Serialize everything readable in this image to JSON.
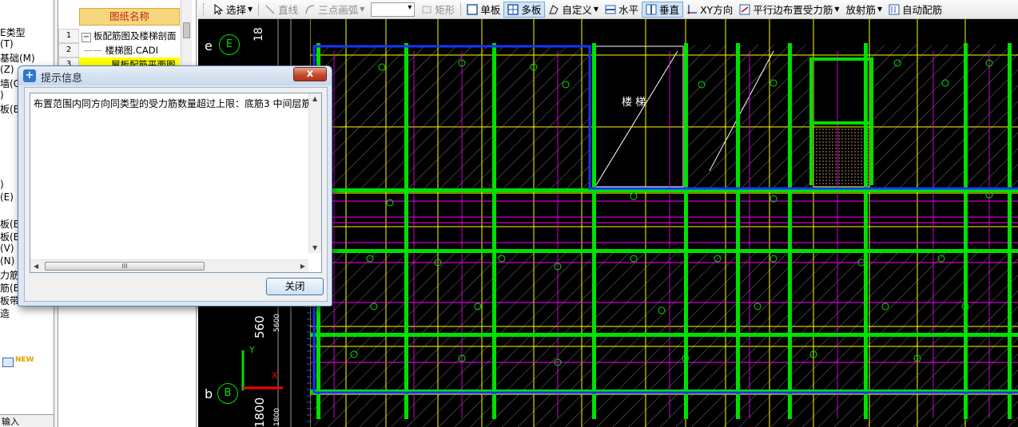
{
  "toolbar": {
    "items": [
      {
        "label": "选择",
        "icon": "cursor-icon",
        "state": "normal",
        "arrow": true
      },
      {
        "label": "直线",
        "icon": "line-icon",
        "state": "disabled"
      },
      {
        "label": "三点画弧",
        "icon": "arc-icon",
        "state": "disabled",
        "arrow": true
      },
      {
        "label": "矩形",
        "icon": "rectangle-icon",
        "state": "disabled"
      },
      {
        "label": "单板",
        "icon": "single-slab-icon",
        "state": "normal"
      },
      {
        "label": "多板",
        "icon": "multi-slab-icon",
        "state": "active"
      },
      {
        "label": "自定义",
        "icon": "custom-icon",
        "state": "normal",
        "arrow": true
      },
      {
        "label": "水平",
        "icon": "horizontal-icon",
        "state": "normal"
      },
      {
        "label": "垂直",
        "icon": "vertical-icon",
        "state": "active"
      },
      {
        "label": "XY方向",
        "icon": "xy-direction-icon",
        "state": "normal"
      },
      {
        "label": "平行边布置受力筋",
        "icon": "parallel-edge-icon",
        "state": "normal",
        "arrow": true
      },
      {
        "label": "放射筋",
        "icon": "radial-rebar-icon",
        "state": "normal",
        "arrow": true
      },
      {
        "label": "自动配筋",
        "icon": "auto-rebar-icon",
        "state": "normal"
      }
    ]
  },
  "left_panel": {
    "items": [
      "E类型",
      "(T)",
      "基础(M)",
      "(Z)",
      "墙(Q)",
      ")",
      "板(B",
      "",
      "",
      "",
      "",
      "",
      ")",
      "(E)",
      "",
      "板(B",
      "板(B",
      "(V)",
      "(N)",
      "力筋",
      "筋(B",
      "板带",
      "造"
    ],
    "new_badge": "NEW",
    "bottom_label": "输入"
  },
  "drawing_panel": {
    "header": "图纸名称",
    "rows": [
      {
        "num": "1",
        "text": "板配筋图及楼梯剖面",
        "prefix": "−"
      },
      {
        "num": "2",
        "text": "楼梯图.CADI",
        "prefix": "——"
      },
      {
        "num": "3",
        "text": "屋板配筋平面图",
        "prefix": ""
      }
    ]
  },
  "dialog": {
    "title": "提示信息",
    "message": "布置范围内同方向同类型的受力筋数量超过上限：底筋3 中间层筋",
    "close_button": "关闭",
    "close_x": "x",
    "scroll_grip": "III",
    "scroll_left": "◀",
    "scroll_right": "▶",
    "scroll_up": "▲",
    "scroll_down": "▼"
  },
  "cad": {
    "room_label": "楼 梯",
    "axis_labels": [
      {
        "lower": "e",
        "circle": "E"
      },
      {
        "lower": "b",
        "circle": "B"
      }
    ],
    "dimension_labels": [
      "18",
      "560",
      "5600",
      "1800",
      "1800"
    ],
    "ucs": {
      "y": "Y",
      "x": "X"
    },
    "colors": {
      "background": "#000000",
      "green": "#00e000",
      "yellow": "#ffff00",
      "magenta": "#ff00ff",
      "blue": "#1a33ff",
      "white": "#ffffff",
      "hatch": "#bfbfbf"
    }
  }
}
